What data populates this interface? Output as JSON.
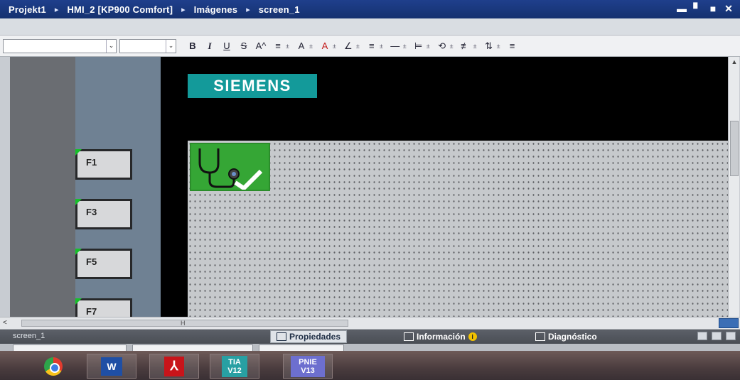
{
  "window": {
    "breadcrumbs": [
      "Projekt1",
      "HMI_2 [KP900 Comfort]",
      "Imágenes",
      "screen_1"
    ],
    "separator": "▸",
    "controls": {
      "minimize": "▬",
      "restore": "▘",
      "maximize": "■",
      "close": "✕"
    }
  },
  "toolbar": {
    "combo_arrow": "⌄",
    "bold": "B",
    "italic": "I",
    "underline": "U",
    "strikethrough": "S",
    "font_size_icon": "A^",
    "align_icon": "≡",
    "text_color": "A",
    "fill_color": "A",
    "line_color": "∠",
    "line_style": "≡",
    "line_width": "—",
    "align_objects": "⊨",
    "rotate": "⟲",
    "distribute": "≢",
    "order": "⇅",
    "more": "≡",
    "dropdown_marker": "±"
  },
  "screen": {
    "logo_text": "SIEMENS",
    "function_keys": [
      "F1",
      "F3",
      "F5",
      "F7"
    ],
    "diagnostics_icon": "stethoscope-check-icon"
  },
  "hscroll": {
    "left_arrow": "<",
    "tick_label": "H"
  },
  "inspector": {
    "screen_name": "screen_1",
    "tabs": [
      {
        "label": "Propiedades",
        "icon": "properties-icon"
      },
      {
        "label": "Información",
        "icon": "info-icon"
      },
      {
        "label": "Diagnóstico",
        "icon": "diagnostics-icon"
      }
    ],
    "info_badge": "i"
  },
  "taskbar": {
    "apps": [
      {
        "name": "chrome",
        "icon": "chrome-icon"
      },
      {
        "name": "word",
        "label": "W"
      },
      {
        "name": "acrobat",
        "label": "⅄"
      },
      {
        "name": "tia_portal_v12",
        "line1": "TIA",
        "line2": "V12"
      },
      {
        "name": "tia_portal_v13",
        "line1": "PNIE",
        "line2": "V13"
      }
    ]
  },
  "colors": {
    "titlebar": "#1f3f8c",
    "siemens_teal": "#139a9a",
    "fkey_indicator": "#16c02a",
    "diag_green": "#35a635"
  }
}
